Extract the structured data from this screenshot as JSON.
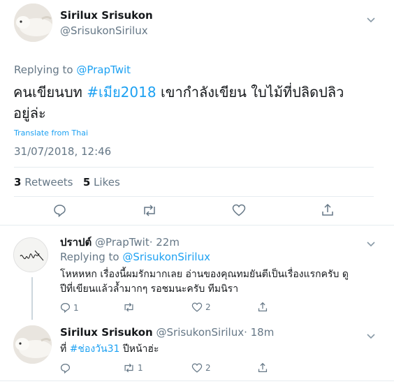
{
  "main_tweet": {
    "author_name": "Sirilux Srisukon",
    "author_handle": "@SrisukonSirilux",
    "reply_prefix": "Replying to",
    "reply_to": "@PrapTwit",
    "text_part1": "คนเขียนบท",
    "hashtag": "#เมีย2018",
    "text_part2": "เขากำลังเขียน ใบไม้ที่ปลิดปลิว",
    "text_line2": "อยู่ล่ะ",
    "translate": "Translate from Thai",
    "timestamp": "31/07/2018, 12:46",
    "retweets_count": "3",
    "retweets_label": "Retweets",
    "likes_count": "5",
    "likes_label": "Likes"
  },
  "replies": [
    {
      "author_name": "ปราปต์",
      "author_handle": "@PrapTwit",
      "time": "· 22m",
      "reply_prefix": "Replying to",
      "reply_to": "@SrisukonSirilux",
      "text_line1": "โหหหหก เรื่องนี้ผมรักมากเลย อ่านของคุณทมยันตีเป็นเรื่องแรกครับ ดู",
      "text_line2": "ปีที่เขียนแล้วล้ำมากๆ รอชมนะครับ ทีมนิรา",
      "reply_count": "1",
      "retweet_count": "",
      "like_count": "2"
    },
    {
      "author_name": "Sirilux Srisukon",
      "author_handle": "@SrisukonSirilux",
      "time": "· 18m",
      "text_part1": "ที่",
      "hashtag": "#ช่องวัน31",
      "text_part2": "ปีหน้าฮ่ะ",
      "reply_count": "",
      "retweet_count": "1",
      "like_count": "2"
    }
  ],
  "colors": {
    "accent": "#1da1f2",
    "muted": "#657786",
    "text": "#14171a",
    "divider": "#e6ecf0"
  },
  "icons": [
    "chevron-down-icon",
    "reply-icon",
    "retweet-icon",
    "like-icon",
    "share-icon"
  ]
}
